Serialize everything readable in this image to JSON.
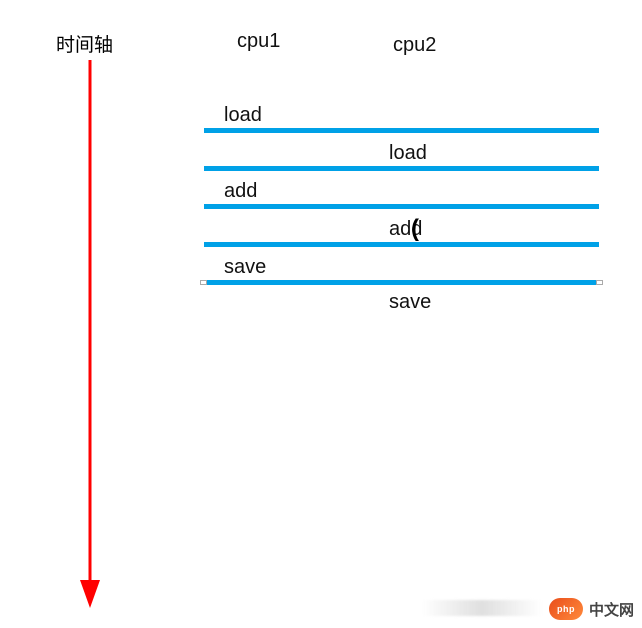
{
  "axis_label": "时间轴",
  "columns": {
    "cpu1": "cpu1",
    "cpu2": "cpu2"
  },
  "ops": {
    "r1": "load",
    "r2": "load",
    "r3": "add",
    "r4": "add",
    "r5": "save",
    "r6": "save"
  },
  "colors": {
    "line": "#00a1e7",
    "arrow": "#ff0000"
  },
  "watermark": {
    "pill": "php",
    "text": "中文网"
  },
  "chart_data": {
    "type": "table",
    "title": "时间轴",
    "columns": [
      "cpu1",
      "cpu2"
    ],
    "rows": [
      {
        "cpu1": "load",
        "cpu2": ""
      },
      {
        "cpu1": "",
        "cpu2": "load"
      },
      {
        "cpu1": "add",
        "cpu2": ""
      },
      {
        "cpu1": "",
        "cpu2": "add"
      },
      {
        "cpu1": "save",
        "cpu2": ""
      },
      {
        "cpu1": "",
        "cpu2": "save"
      }
    ]
  }
}
